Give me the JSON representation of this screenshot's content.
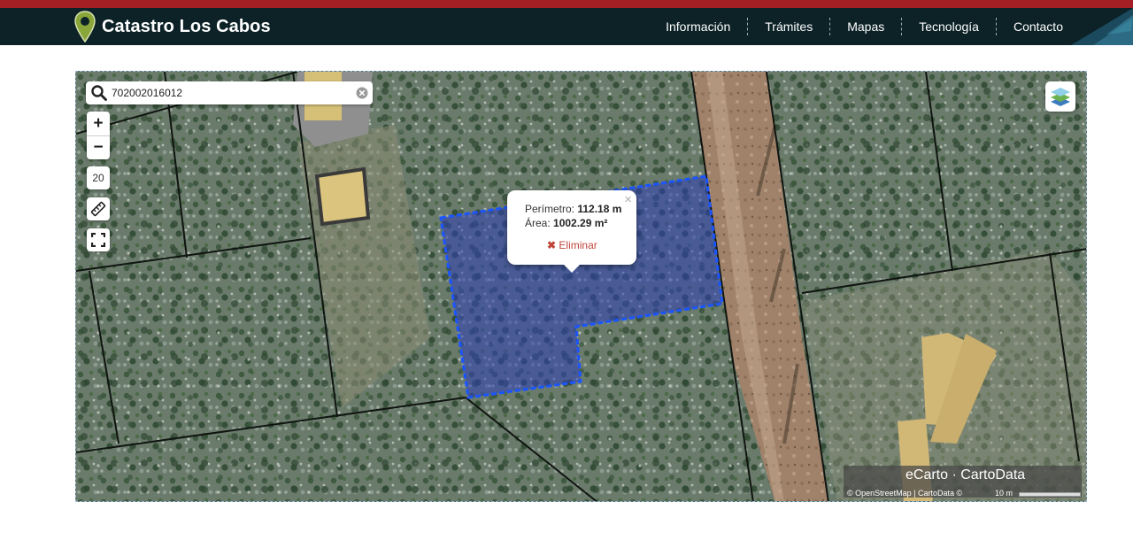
{
  "header": {
    "brand_title": "Catastro Los Cabos",
    "nav_items": [
      "Información",
      "Trámites",
      "Mapas",
      "Tecnología",
      "Contacto"
    ],
    "accent_color": "#a31f24",
    "nav_bg": "#0c2227"
  },
  "map": {
    "search": {
      "value": "702002016012",
      "icon": "search-icon",
      "clear_icon": "clear-icon"
    },
    "zoom_in_label": "+",
    "zoom_out_label": "−",
    "zoom_level": "20",
    "measure_icon": "ruler-icon",
    "fullscreen_icon": "fullscreen-icon",
    "layers_icon": "layers-icon",
    "popup": {
      "perimeter_label": "Perímetro:",
      "perimeter_value": "112.18 m",
      "area_label": "Área:",
      "area_value": "1002.29 m²",
      "delete_label": "Eliminar",
      "close_label": "×"
    },
    "brand_box": {
      "title": "eCarto · CartoData",
      "attribution": "© OpenStreetMap | CartoData ©",
      "scale_label": "10 m"
    },
    "selection_color": "#1a55ff"
  }
}
